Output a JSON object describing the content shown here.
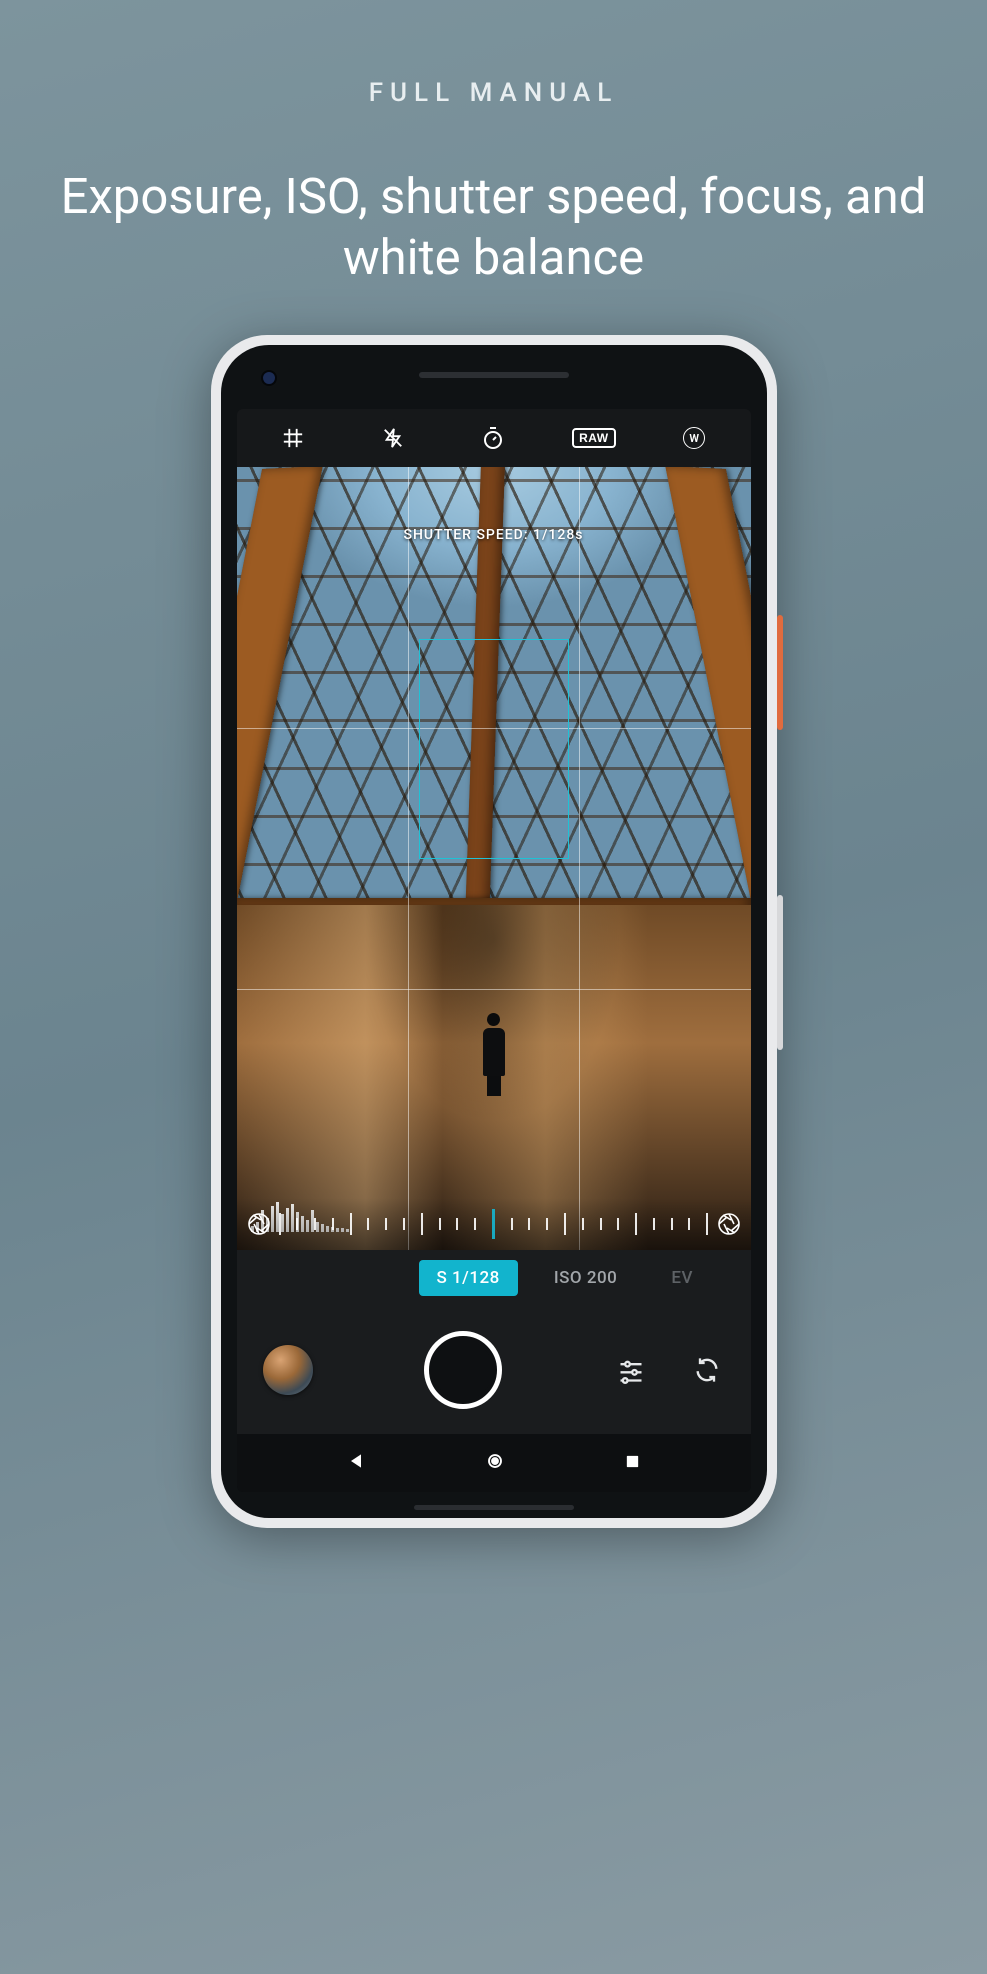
{
  "promo": {
    "eyebrow": "FULL MANUAL",
    "title": "Exposure, ISO, shutter speed, focus, and white balance"
  },
  "toolbar": {
    "grid_icon": "grid",
    "flash_icon": "flash-off",
    "timer_icon": "timer",
    "raw_label": "RAW",
    "wb_label": "W"
  },
  "viewfinder": {
    "overlay_label": "SHUTTER SPEED: 1/128s"
  },
  "mode_tabs": {
    "shutter": "S 1/128",
    "iso": "ISO 200",
    "ev": "EV"
  },
  "colors": {
    "accent": "#12b4cd"
  }
}
